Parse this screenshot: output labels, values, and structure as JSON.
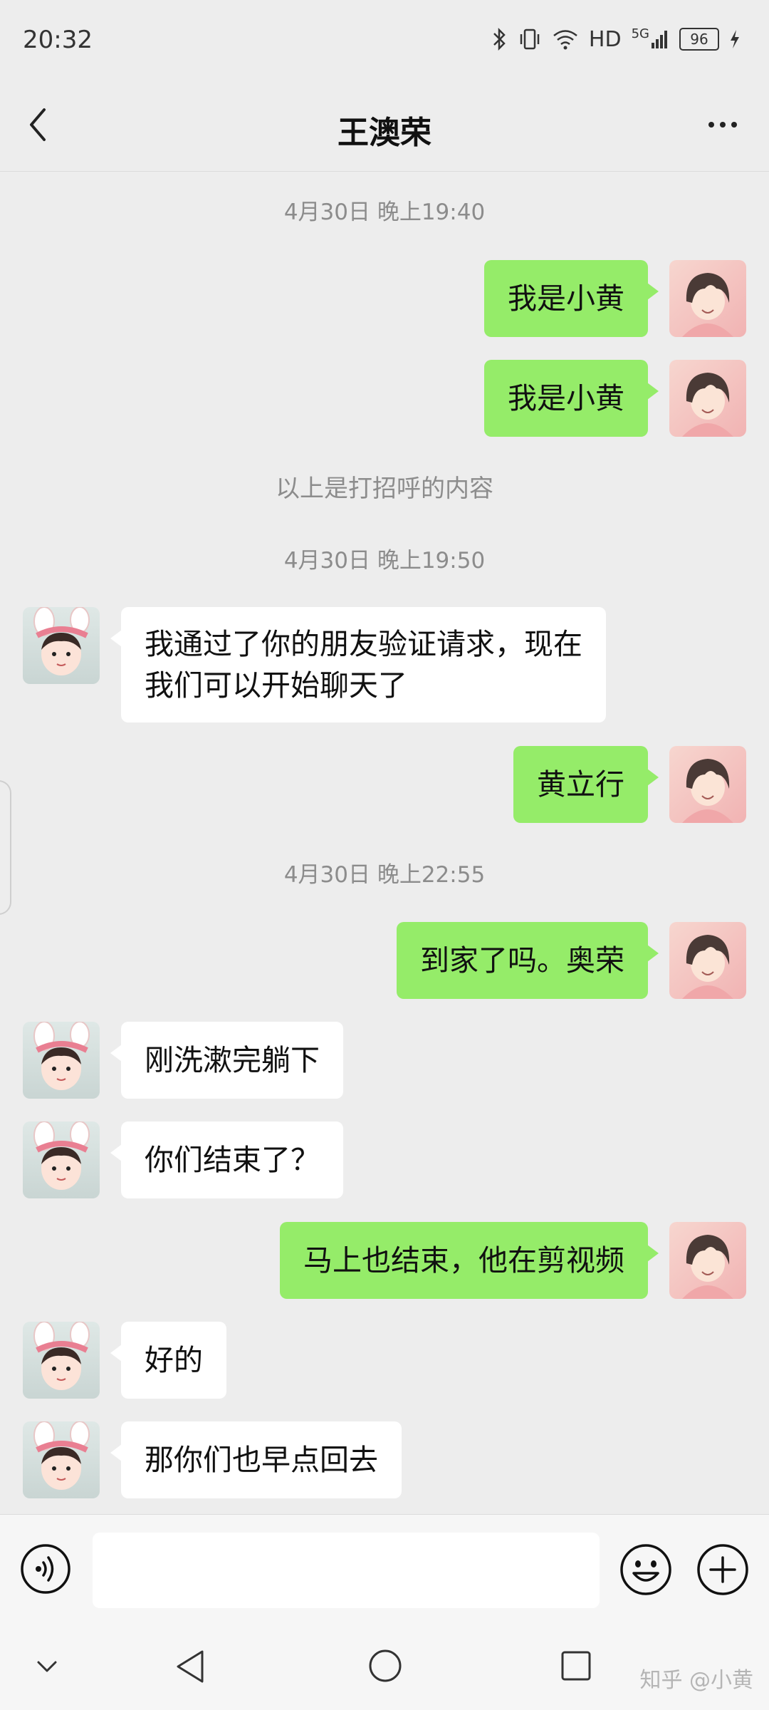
{
  "status_bar": {
    "time": "20:32",
    "network": "HD",
    "signal": "5G",
    "battery": "96"
  },
  "header": {
    "title": "王澳荣"
  },
  "messages": [
    {
      "kind": "time",
      "text": "4月30日 晚上19:40"
    },
    {
      "kind": "me",
      "text": "我是小黄"
    },
    {
      "kind": "me",
      "text": "我是小黄"
    },
    {
      "kind": "system",
      "text": "以上是打招呼的内容"
    },
    {
      "kind": "time",
      "text": "4月30日 晚上19:50"
    },
    {
      "kind": "peer",
      "text": "我通过了你的朋友验证请求，现在\n我们可以开始聊天了"
    },
    {
      "kind": "me",
      "text": "黄立行"
    },
    {
      "kind": "time",
      "text": "4月30日 晚上22:55"
    },
    {
      "kind": "me",
      "text": "到家了吗。奥荣"
    },
    {
      "kind": "peer",
      "text": "刚洗漱完躺下"
    },
    {
      "kind": "peer",
      "text": "你们结束了？"
    },
    {
      "kind": "me",
      "text": "马上也结束，他在剪视频"
    },
    {
      "kind": "peer",
      "text": "好的"
    },
    {
      "kind": "peer",
      "text": "那你们也早点回去"
    }
  ],
  "input_bar": {
    "value": "",
    "icons": [
      "voice-icon",
      "emoji-icon",
      "plus-icon"
    ]
  },
  "nav_bar": {
    "icons": [
      "chevron-down-icon",
      "back-triangle-icon",
      "home-circle-icon",
      "recents-square-icon"
    ],
    "watermark": "知乎 @小黄"
  },
  "colors": {
    "background": "#ededed",
    "my_bubble": "#95ec69",
    "peer_bubble": "#ffffff"
  }
}
